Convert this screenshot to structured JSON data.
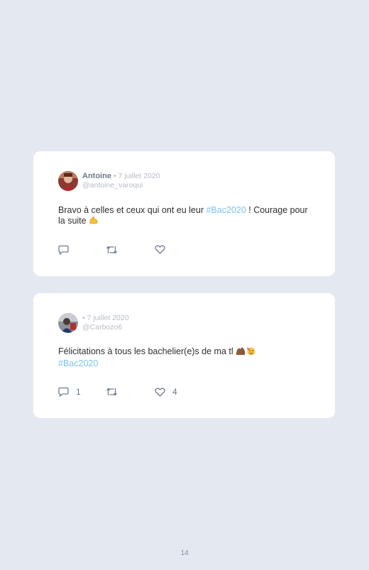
{
  "tweets": [
    {
      "name": "Antoine",
      "separator": " • ",
      "date": "7 juillet 2020",
      "handle": "@antoine_varoqui",
      "text_before": "Bravo à celles et ceux qui ont eu leur ",
      "hashtag": "#Bac2020",
      "text_after": " ! Courage pour la suite ",
      "emoji": "flexed-biceps",
      "reply_count": "",
      "retweet_count": "",
      "like_count": ""
    },
    {
      "name": "",
      "separator": " • ",
      "date": "7 juillet 2020",
      "handle": "@Carbozo6",
      "text_before": "Félicitations à tous les bachelier(e)s de ma tl ",
      "hashtag": "#Bac2020",
      "text_after": "",
      "emoji": "raised-hands-party-face",
      "reply_count": "1",
      "retweet_count": "",
      "like_count": "4"
    }
  ],
  "page_number": "14",
  "colors": {
    "background": "#e4e8f1",
    "card": "#ffffff",
    "hashtag": "#7cc4ea",
    "icon": "#6f7c8e"
  }
}
